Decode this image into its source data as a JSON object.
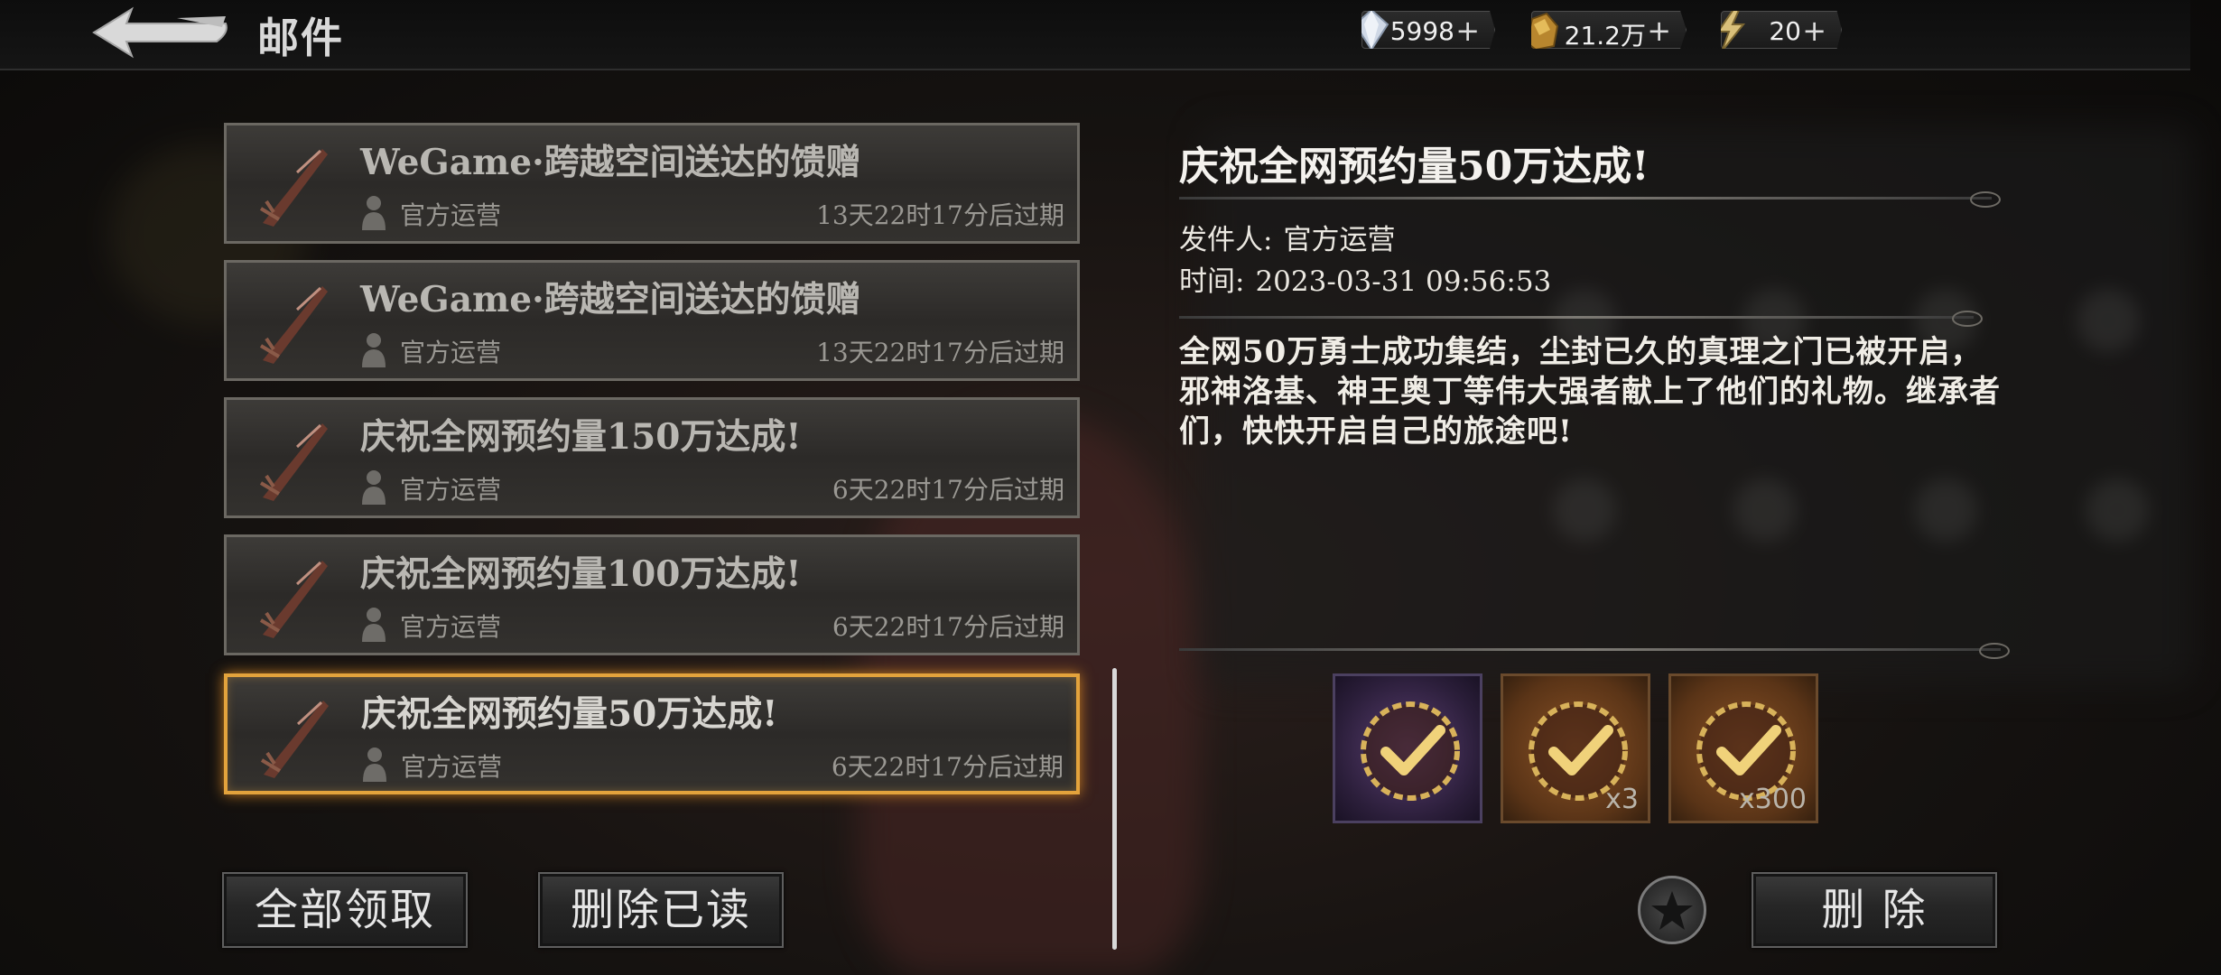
{
  "header": {
    "title": "邮件",
    "currencies": [
      {
        "icon": "diamond-icon",
        "value": "5998",
        "plus": "+"
      },
      {
        "icon": "gold-ore-icon",
        "value": "21.2万",
        "plus": "+"
      },
      {
        "icon": "lightning-icon",
        "value": "20",
        "plus": "+"
      }
    ]
  },
  "mail_list": [
    {
      "title": "WeGame·跨越空间送达的馈赠",
      "sender": "官方运营",
      "expire": "13天22时17分后过期"
    },
    {
      "title": "WeGame·跨越空间送达的馈赠",
      "sender": "官方运营",
      "expire": "13天22时17分后过期"
    },
    {
      "title": "庆祝全网预约量150万达成!",
      "sender": "官方运营",
      "expire": "6天22时17分后过期"
    },
    {
      "title": "庆祝全网预约量100万达成!",
      "sender": "官方运营",
      "expire": "6天22时17分后过期"
    },
    {
      "title": "庆祝全网预约量50万达成!",
      "sender": "官方运营",
      "expire": "6天22时17分后过期"
    }
  ],
  "buttons": {
    "claim_all": "全部领取",
    "delete_read": "删除已读",
    "delete": "删 除"
  },
  "detail": {
    "title": "庆祝全网预约量50万达成!",
    "sender_label": "发件人:",
    "sender": "官方运营",
    "time_label": "时间:",
    "time": "2023-03-31 09:56:53",
    "body": "全网50万勇士成功集结，尘封已久的真理之门已被开启，邪神洛基、神王奥丁等伟大强者献上了他们的礼物。继承者们，快快开启自己的旅途吧!"
  },
  "rewards": [
    {
      "icon": "claimed-check-icon",
      "quantity": ""
    },
    {
      "icon": "claimed-check-icon",
      "quantity": "x3"
    },
    {
      "icon": "claimed-check-icon",
      "quantity": "x300"
    }
  ],
  "colors": {
    "selected_border": "#e3a33c",
    "claimed_check": "#e8c46a"
  }
}
